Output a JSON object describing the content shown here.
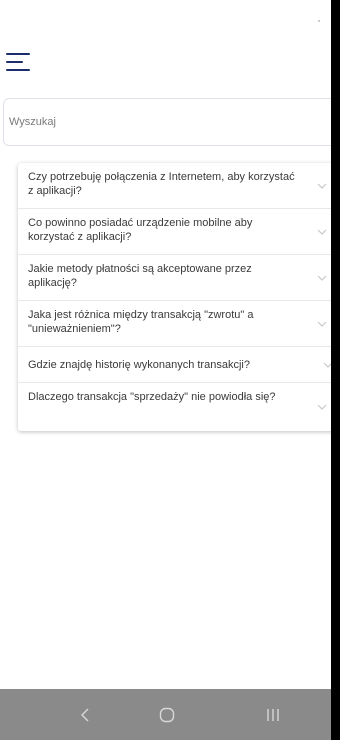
{
  "header": {
    "menu_icon": "hamburger-menu-icon"
  },
  "search": {
    "placeholder": "Wyszukaj"
  },
  "faq": {
    "items": [
      {
        "question": "Czy potrzebuję połączenia z Internetem, aby korzystać z aplikacji?"
      },
      {
        "question": "Co powinno posiadać urządzenie mobilne aby korzystać z aplikacji?"
      },
      {
        "question": "Jakie metody płatności są akceptowane przez aplikację?"
      },
      {
        "question": "Jaka jest różnica między transakcją \"zwrotu\" a \"unieważnieniem\"?"
      },
      {
        "question": "Gdzie znajdę historię wykonanych transakcji?"
      },
      {
        "question": "Dlaczego transakcja \"sprzedaży\" nie powiodła się?"
      }
    ],
    "chevron_icon": "chevron-down-icon"
  },
  "navigation": {
    "back_icon": "back-icon",
    "home_icon": "home-icon",
    "recent_icon": "recent-apps-icon"
  },
  "colors": {
    "accent": "#1b2d6b",
    "nav_bar": "#8a8a8a",
    "text": "#3a3a3a"
  }
}
